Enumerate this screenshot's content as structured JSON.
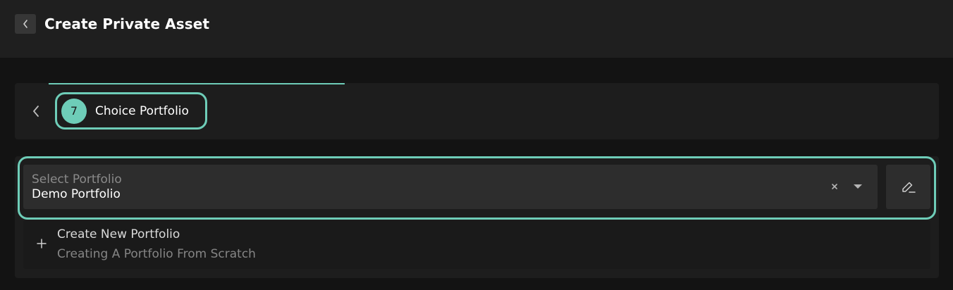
{
  "header": {
    "back_icon": "chevron-left-icon",
    "title": "Create Private Asset"
  },
  "step": {
    "progress_fraction": 0.32,
    "back_icon": "chevron-left-icon",
    "number": "7",
    "label": "Choice Portfolio"
  },
  "portfolio_select": {
    "label": "Select Portfolio",
    "value": "Demo Portfolio",
    "clear_icon": "close-icon",
    "dropdown_icon": "caret-down-icon",
    "edit_icon": "pencil-icon"
  },
  "create_option": {
    "icon": "plus-icon",
    "title": "Create New Portfolio",
    "subtitle": "Creating A Portfolio From Scratch"
  },
  "colors": {
    "accent": "#6ecdb8",
    "background": "#131313",
    "panel": "#1d1d1d",
    "field": "#2d2d2d"
  }
}
